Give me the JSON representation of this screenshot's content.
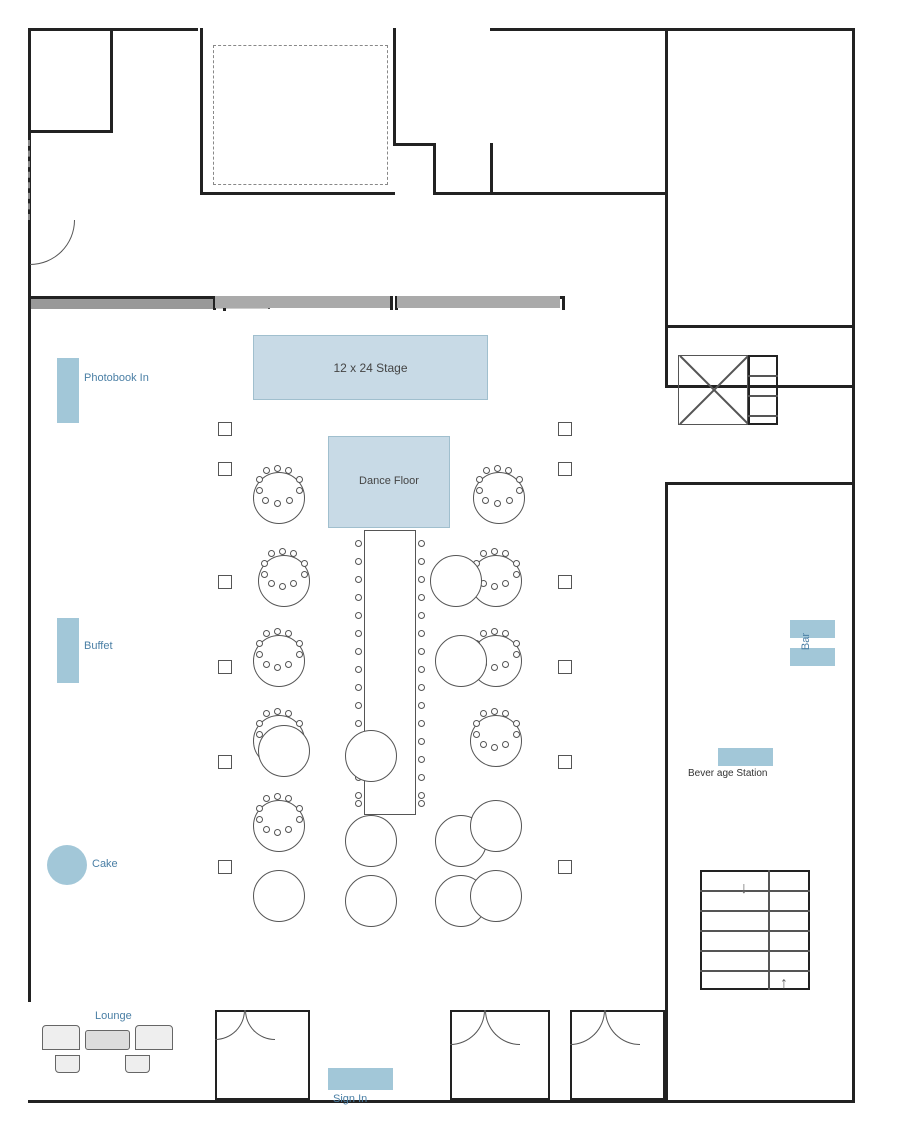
{
  "labels": {
    "stage": "12 x 24 Stage",
    "dance_floor": "Dance Floor",
    "photobook": "Photobook In",
    "buffet": "Buffet",
    "cake": "Cake",
    "lounge": "Lounge",
    "sign_in": "Sign In",
    "bar": "Bar",
    "beverage_station": "Bever age Station"
  },
  "colors": {
    "wall": "#222222",
    "blue_accent": "#7bafc8",
    "light_blue": "#c8dae6",
    "label_blue": "#4a7fa5"
  }
}
